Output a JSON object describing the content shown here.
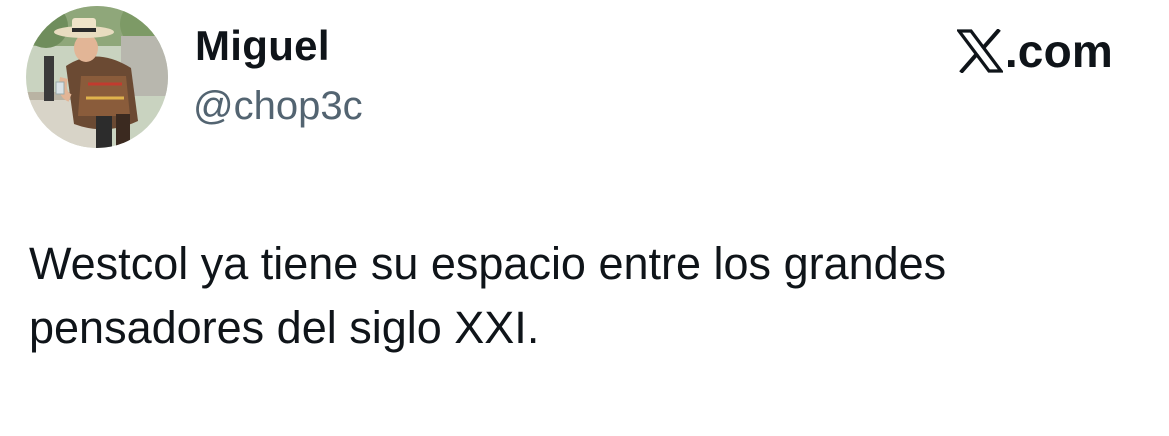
{
  "author": {
    "name": "Miguel",
    "handle": "@chop3c",
    "avatar_icon": "profile-photo"
  },
  "source": {
    "logo_icon": "x-logo-icon",
    "domain": ".com"
  },
  "tweet": {
    "text": "Westcol ya tiene su espacio entre los grandes\npensadores del siglo XXI."
  },
  "colors": {
    "text_primary": "#0f1419",
    "text_secondary": "#536471",
    "background": "#ffffff"
  }
}
